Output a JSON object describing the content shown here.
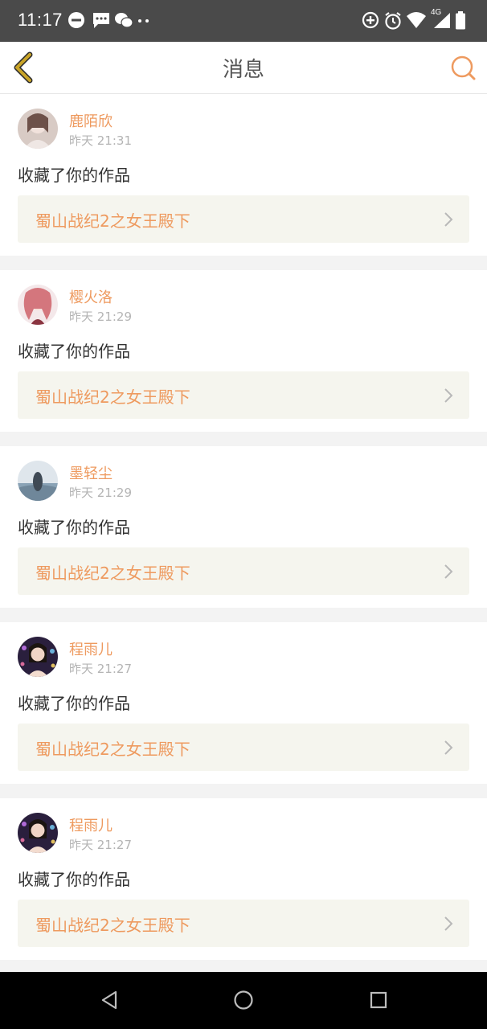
{
  "status_bar": {
    "time": "11:17",
    "network": "4G",
    "icons": [
      "do-not-disturb-icon",
      "message-icon",
      "wechat-icon",
      "more-dots-icon",
      "data-saver-icon",
      "alarm-icon",
      "wifi-icon",
      "signal-icon",
      "battery-icon"
    ]
  },
  "header": {
    "title": "消息",
    "back_icon": "chevron-left-icon",
    "search_icon": "search-icon"
  },
  "colors": {
    "accent": "#ee9a5f",
    "back_icon": "#c9a428",
    "status_bar": "#4a4a4a",
    "card_link_bg": "#f5f5ee"
  },
  "messages": [
    {
      "username": "鹿陌欣",
      "time": "昨天 21:31",
      "action": "收藏了你的作品",
      "work": "蜀山战纪2之女王殿下"
    },
    {
      "username": "樱火洛",
      "time": "昨天 21:29",
      "action": "收藏了你的作品",
      "work": "蜀山战纪2之女王殿下"
    },
    {
      "username": "墨轻尘",
      "time": "昨天 21:29",
      "action": "收藏了你的作品",
      "work": "蜀山战纪2之女王殿下"
    },
    {
      "username": "程雨儿",
      "time": "昨天 21:27",
      "action": "收藏了你的作品",
      "work": "蜀山战纪2之女王殿下"
    },
    {
      "username": "程雨儿",
      "time": "昨天 21:27",
      "action": "收藏了你的作品",
      "work": "蜀山战纪2之女王殿下"
    }
  ],
  "bottom_nav": [
    "back-triangle-icon",
    "home-circle-icon",
    "recents-square-icon"
  ]
}
